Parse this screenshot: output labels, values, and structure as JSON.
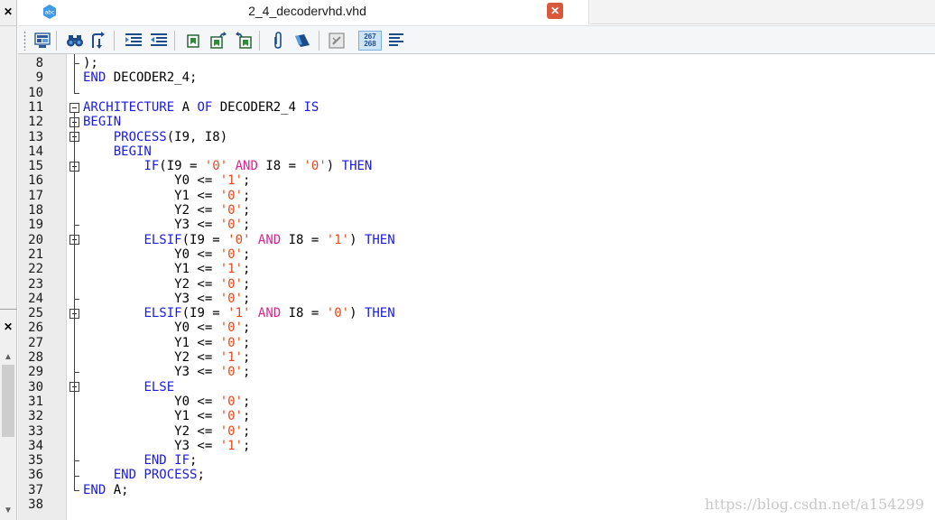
{
  "tab": {
    "title": "2_4_decodervhd.vhd",
    "close_glyph": "✕",
    "doc_icon": "abc-document-icon"
  },
  "left_strip": {
    "close_glyph_top": "✕",
    "close_glyph_mid": "✕",
    "scroll_up_glyph": "▲",
    "scroll_down_glyph": "▼"
  },
  "toolbar": {
    "buttons": [
      {
        "name": "print-preview-button",
        "icon": "print-preview-icon"
      },
      {
        "name": "find-button",
        "icon": "binoculars-icon"
      },
      {
        "name": "replace-button",
        "icon": "replace-icon"
      },
      {
        "name": "indent-button",
        "icon": "indent-icon"
      },
      {
        "name": "outdent-button",
        "icon": "outdent-icon"
      },
      {
        "name": "bookmark-button",
        "icon": "bookmark-icon"
      },
      {
        "name": "next-bookmark-button",
        "icon": "next-bookmark-icon"
      },
      {
        "name": "prev-bookmark-button",
        "icon": "prev-bookmark-icon"
      },
      {
        "name": "attach-button",
        "icon": "paperclip-icon"
      },
      {
        "name": "erase-button",
        "icon": "eraser-icon"
      },
      {
        "name": "ignore-button",
        "icon": "ignore-icon"
      },
      {
        "name": "line-numbers-button",
        "icon": "line-numbers-icon"
      },
      {
        "name": "wrap-button",
        "icon": "word-wrap-icon"
      }
    ],
    "line_numbers_top": "267",
    "line_numbers_bottom": "268"
  },
  "editor": {
    "line_numbers": [
      "8",
      "9",
      "10",
      "11",
      "12",
      "13",
      "14",
      "15",
      "16",
      "17",
      "18",
      "19",
      "20",
      "21",
      "22",
      "23",
      "24",
      "25",
      "26",
      "27",
      "28",
      "29",
      "30",
      "31",
      "32",
      "33",
      "34",
      "35",
      "36",
      "37",
      "38"
    ],
    "lines": [
      [
        {
          "t": ");",
          "c": ""
        }
      ],
      [
        {
          "t": "END",
          "c": "kw"
        },
        {
          "t": " DECODER2_4;",
          "c": ""
        }
      ],
      [],
      [
        {
          "t": "ARCHITECTURE",
          "c": "kw"
        },
        {
          "t": " A ",
          "c": ""
        },
        {
          "t": "OF",
          "c": "kw"
        },
        {
          "t": " DECODER2_4 ",
          "c": ""
        },
        {
          "t": "IS",
          "c": "kw"
        }
      ],
      [
        {
          "t": "BEGIN",
          "c": "kw"
        }
      ],
      [
        {
          "t": "    ",
          "c": ""
        },
        {
          "t": "PROCESS",
          "c": "kw"
        },
        {
          "t": "(I9, I8)",
          "c": ""
        }
      ],
      [
        {
          "t": "    ",
          "c": ""
        },
        {
          "t": "BEGIN",
          "c": "kw"
        }
      ],
      [
        {
          "t": "        ",
          "c": ""
        },
        {
          "t": "IF",
          "c": "kw"
        },
        {
          "t": "(I9 = ",
          "c": ""
        },
        {
          "t": "'0'",
          "c": "str"
        },
        {
          "t": " ",
          "c": ""
        },
        {
          "t": "AND",
          "c": "op"
        },
        {
          "t": " I8 = ",
          "c": ""
        },
        {
          "t": "'0'",
          "c": "str"
        },
        {
          "t": ") ",
          "c": ""
        },
        {
          "t": "THEN",
          "c": "kw"
        }
      ],
      [
        {
          "t": "            Y0 <= ",
          "c": ""
        },
        {
          "t": "'1'",
          "c": "str"
        },
        {
          "t": ";",
          "c": ""
        }
      ],
      [
        {
          "t": "            Y1 <= ",
          "c": ""
        },
        {
          "t": "'0'",
          "c": "str"
        },
        {
          "t": ";",
          "c": ""
        }
      ],
      [
        {
          "t": "            Y2 <= ",
          "c": ""
        },
        {
          "t": "'0'",
          "c": "str"
        },
        {
          "t": ";",
          "c": ""
        }
      ],
      [
        {
          "t": "            Y3 <= ",
          "c": ""
        },
        {
          "t": "'0'",
          "c": "str"
        },
        {
          "t": ";",
          "c": ""
        }
      ],
      [
        {
          "t": "        ",
          "c": ""
        },
        {
          "t": "ELSIF",
          "c": "kw"
        },
        {
          "t": "(I9 = ",
          "c": ""
        },
        {
          "t": "'0'",
          "c": "str"
        },
        {
          "t": " ",
          "c": ""
        },
        {
          "t": "AND",
          "c": "op"
        },
        {
          "t": " I8 = ",
          "c": ""
        },
        {
          "t": "'1'",
          "c": "str"
        },
        {
          "t": ") ",
          "c": ""
        },
        {
          "t": "THEN",
          "c": "kw"
        }
      ],
      [
        {
          "t": "            Y0 <= ",
          "c": ""
        },
        {
          "t": "'0'",
          "c": "str"
        },
        {
          "t": ";",
          "c": ""
        }
      ],
      [
        {
          "t": "            Y1 <= ",
          "c": ""
        },
        {
          "t": "'1'",
          "c": "str"
        },
        {
          "t": ";",
          "c": ""
        }
      ],
      [
        {
          "t": "            Y2 <= ",
          "c": ""
        },
        {
          "t": "'0'",
          "c": "str"
        },
        {
          "t": ";",
          "c": ""
        }
      ],
      [
        {
          "t": "            Y3 <= ",
          "c": ""
        },
        {
          "t": "'0'",
          "c": "str"
        },
        {
          "t": ";",
          "c": ""
        }
      ],
      [
        {
          "t": "        ",
          "c": ""
        },
        {
          "t": "ELSIF",
          "c": "kw"
        },
        {
          "t": "(I9 = ",
          "c": ""
        },
        {
          "t": "'1'",
          "c": "str"
        },
        {
          "t": " ",
          "c": ""
        },
        {
          "t": "AND",
          "c": "op"
        },
        {
          "t": " I8 = ",
          "c": ""
        },
        {
          "t": "'0'",
          "c": "str"
        },
        {
          "t": ") ",
          "c": ""
        },
        {
          "t": "THEN",
          "c": "kw"
        }
      ],
      [
        {
          "t": "            Y0 <= ",
          "c": ""
        },
        {
          "t": "'0'",
          "c": "str"
        },
        {
          "t": ";",
          "c": ""
        }
      ],
      [
        {
          "t": "            Y1 <= ",
          "c": ""
        },
        {
          "t": "'0'",
          "c": "str"
        },
        {
          "t": ";",
          "c": ""
        }
      ],
      [
        {
          "t": "            Y2 <= ",
          "c": ""
        },
        {
          "t": "'1'",
          "c": "str"
        },
        {
          "t": ";",
          "c": ""
        }
      ],
      [
        {
          "t": "            Y3 <= ",
          "c": ""
        },
        {
          "t": "'0'",
          "c": "str"
        },
        {
          "t": ";",
          "c": ""
        }
      ],
      [
        {
          "t": "        ",
          "c": ""
        },
        {
          "t": "ELSE",
          "c": "kw"
        }
      ],
      [
        {
          "t": "            Y0 <= ",
          "c": ""
        },
        {
          "t": "'0'",
          "c": "str"
        },
        {
          "t": ";",
          "c": ""
        }
      ],
      [
        {
          "t": "            Y1 <= ",
          "c": ""
        },
        {
          "t": "'0'",
          "c": "str"
        },
        {
          "t": ";",
          "c": ""
        }
      ],
      [
        {
          "t": "            Y2 <= ",
          "c": ""
        },
        {
          "t": "'0'",
          "c": "str"
        },
        {
          "t": ";",
          "c": ""
        }
      ],
      [
        {
          "t": "            Y3 <= ",
          "c": ""
        },
        {
          "t": "'1'",
          "c": "str"
        },
        {
          "t": ";",
          "c": ""
        }
      ],
      [
        {
          "t": "        ",
          "c": ""
        },
        {
          "t": "END IF",
          "c": "kw"
        },
        {
          "t": ";",
          "c": ""
        }
      ],
      [
        {
          "t": "    ",
          "c": ""
        },
        {
          "t": "END PROCESS",
          "c": "kw"
        },
        {
          "t": ";",
          "c": ""
        }
      ],
      [
        {
          "t": "END",
          "c": "kw"
        },
        {
          "t": " A;",
          "c": ""
        }
      ],
      []
    ],
    "fold_markers": [
      {
        "line": "11",
        "kind": "box"
      },
      {
        "line": "12",
        "kind": "box"
      },
      {
        "line": "13",
        "kind": "box"
      },
      {
        "line": "15",
        "kind": "box"
      },
      {
        "line": "20",
        "kind": "box"
      },
      {
        "line": "25",
        "kind": "box"
      },
      {
        "line": "30",
        "kind": "box"
      }
    ]
  },
  "watermark": "https://blog.csdn.net/a154299",
  "colors": {
    "keyword": "#1a1ae6",
    "operator": "#e0248f",
    "string": "#e8491b",
    "gutter": "#ececec",
    "close_tab": "#d9583b"
  }
}
